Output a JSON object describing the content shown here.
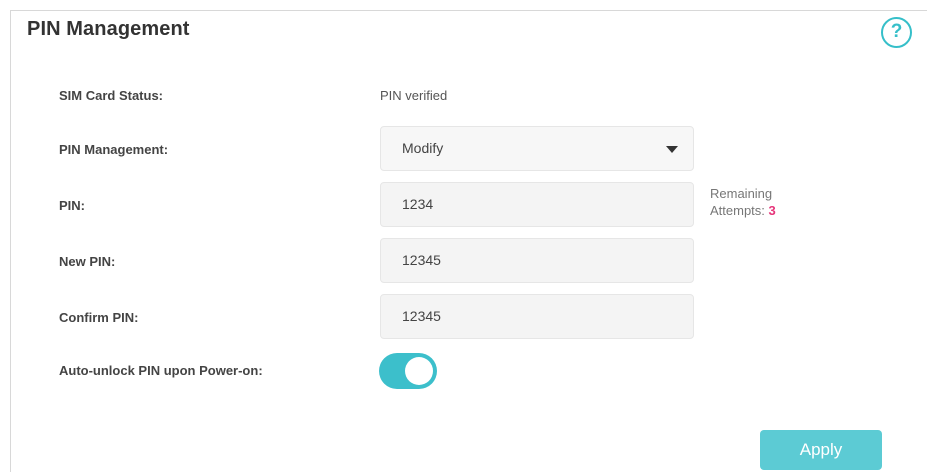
{
  "page": {
    "title": "PIN Management",
    "help_icon_glyph": "?"
  },
  "form": {
    "sim_status_label": "SIM Card Status:",
    "sim_status_value": "PIN verified",
    "pin_mgmt_label": "PIN Management:",
    "pin_mgmt_value": "Modify",
    "pin_label": "PIN:",
    "pin_value": "1234",
    "remaining_label": "Remaining",
    "attempts_label": "Attempts:",
    "attempts_count": "3",
    "new_pin_label": "New PIN:",
    "new_pin_value": "12345",
    "confirm_pin_label": "Confirm PIN:",
    "confirm_pin_value": "12345",
    "auto_unlock_label": "Auto-unlock PIN upon Power-on:",
    "auto_unlock_on": true
  },
  "actions": {
    "apply_label": "Apply"
  },
  "colors": {
    "accent": "#3cbfcb",
    "attempts": "#e6357a"
  }
}
